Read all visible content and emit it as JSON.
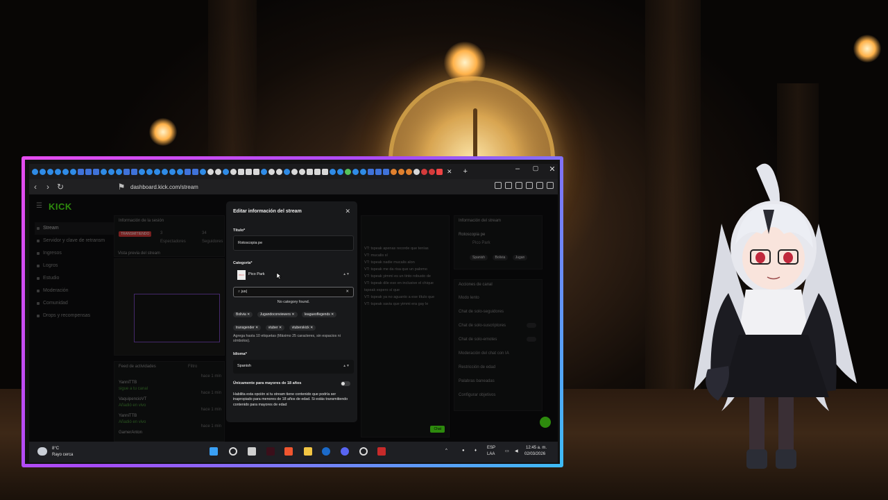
{
  "browser": {
    "url": "dashboard.kick.com/stream",
    "window_controls": {
      "minimize": "–",
      "maximize": "▢",
      "close": "✕"
    },
    "new_tab": "+",
    "tab_close": "✕"
  },
  "kick": {
    "logo": "KICK",
    "sidebar": {
      "items": [
        {
          "label": "Stream",
          "icon": "stream-icon"
        },
        {
          "label": "Servidor y clave de retransm",
          "icon": "key-icon"
        },
        {
          "label": "Ingresos",
          "icon": "money-icon"
        },
        {
          "label": "Logros",
          "icon": "trophy-icon"
        },
        {
          "label": "Estudio",
          "icon": "studio-icon"
        },
        {
          "label": "Moderación",
          "icon": "shield-icon"
        },
        {
          "label": "Comunidad",
          "icon": "people-icon"
        },
        {
          "label": "Drops y recompensas",
          "icon": "gift-icon"
        }
      ]
    },
    "session": {
      "title": "Información de la sesión",
      "live_badge": "TRANSMITIENDO",
      "stat1_value": "3",
      "stat1_label": "Espectadores",
      "stat2_value": "34",
      "stat2_label": "Seguidores",
      "preview_title": "Vista previa del stream"
    },
    "activity": {
      "title": "Feed de actividades",
      "filter": "Filtro",
      "items": [
        {
          "name": "YanniTTB",
          "sub": "sigue a tu canal",
          "time": "hace 1 min"
        },
        {
          "name": "VaquipencioVT",
          "sub": "Añadió en vivo",
          "time": "hace 1 min"
        },
        {
          "name": "YanniTTB",
          "sub": "Añadió en vivo",
          "time": "hace 1 min"
        },
        {
          "name": "GamerAnton",
          "sub": "",
          "time": "hace 1 min"
        }
      ]
    },
    "chat": {
      "lines": [
        "VT: tspeak apenas recorde que tenías",
        "VT: mucalis sí",
        "VT: tspeak nadie mucalis alon",
        "VT: tspeak me da risa que un palomo",
        "VT: tspeak yimmi es un tinto robusto de",
        "VT: tspeak dile eso en inclusive el chique",
        "tspeak espero sí que",
        "VT: tspeak ya no aguanto a ese título que",
        "VT: tspeak savia que yimmi era gay le"
      ],
      "send": "Chat"
    },
    "stream_info": {
      "title": "Información del stream",
      "name": "Rotoscopia pe",
      "category": "Pico Park",
      "tags": [
        "Spanish",
        "Bolivia",
        "Jugan"
      ]
    },
    "channel_actions": {
      "title": "Acciones de canal",
      "items": [
        "Modo lento",
        "Chat de solo-seguidores",
        "Chat de solo-suscriptores",
        "Chat de solo-emotes",
        "Moderación del chat con IA",
        "Restricción de edad",
        "Palabras baneadas",
        "Configurar objetivos"
      ]
    }
  },
  "modal": {
    "title": "Editar información del stream",
    "title_label": "Título*",
    "title_value": "Rotoscopia pe",
    "category_label": "Categoría*",
    "category_value": "Pico Park",
    "category_thumb": "PICO",
    "search_value": "jus|",
    "no_result": "No category found.",
    "tags": [
      "Bolivia",
      "Jugandoconviewers",
      "leagueoflegends",
      "transgender",
      "vtuber",
      "vtuberskick"
    ],
    "tags_help": "Agrega hasta 10 etiquetas (Máximo 25 caracteres, sin espacios ni símbolos).",
    "language_label": "Idioma*",
    "language_value": "Spanish",
    "mature_label": "Únicamente para mayores de 18 años",
    "mature_help": "Habilita esta opción si tu stream tiene contenido que podría ser inapropiado para menores de 18 años de edad. Si estás transmitiendo contenido para mayores de edad"
  },
  "taskbar": {
    "weather_temp": "8°C",
    "weather_text": "Rayo cerca",
    "lang_top": "ESP",
    "lang_bottom": "LAA",
    "time": "12:45 a. m.",
    "date": "02/03/2026",
    "apps": [
      "start-icon",
      "search-icon",
      "taskview-icon",
      "app-icon",
      "brave-icon",
      "folder-icon",
      "steam-icon",
      "discord-icon",
      "obs-icon",
      "app-red-icon"
    ]
  },
  "colors": {
    "kick_green": "#53fc18",
    "frame_pink": "#e64cf0",
    "frame_blue": "#3dbcf5",
    "live_red": "#d93a3a"
  }
}
